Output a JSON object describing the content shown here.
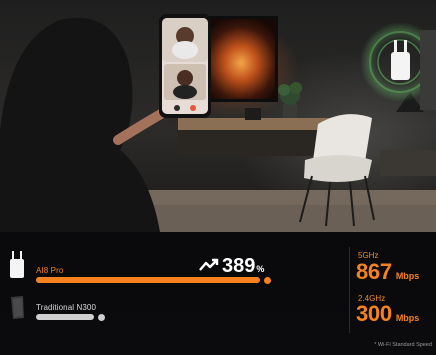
{
  "comparison": {
    "primary": {
      "name": "AI8 Pro",
      "fraction": 1.0,
      "color": "#f5821f"
    },
    "secondary": {
      "name": "Traditional N300",
      "fraction": 0.26,
      "color": "#cfcfcf"
    },
    "gain": {
      "value": "389",
      "unit": "%",
      "icon": "trend-up-arrow-icon"
    }
  },
  "speeds": [
    {
      "band": "5GHz",
      "value": "867",
      "unit": "Mbps"
    },
    {
      "band": "2.4GHz",
      "value": "300",
      "unit": "Mbps"
    }
  ],
  "footnote": "* Wi-Fi Standard Speed",
  "colors": {
    "accent": "#f5821f",
    "background": "#0b0b0d"
  }
}
